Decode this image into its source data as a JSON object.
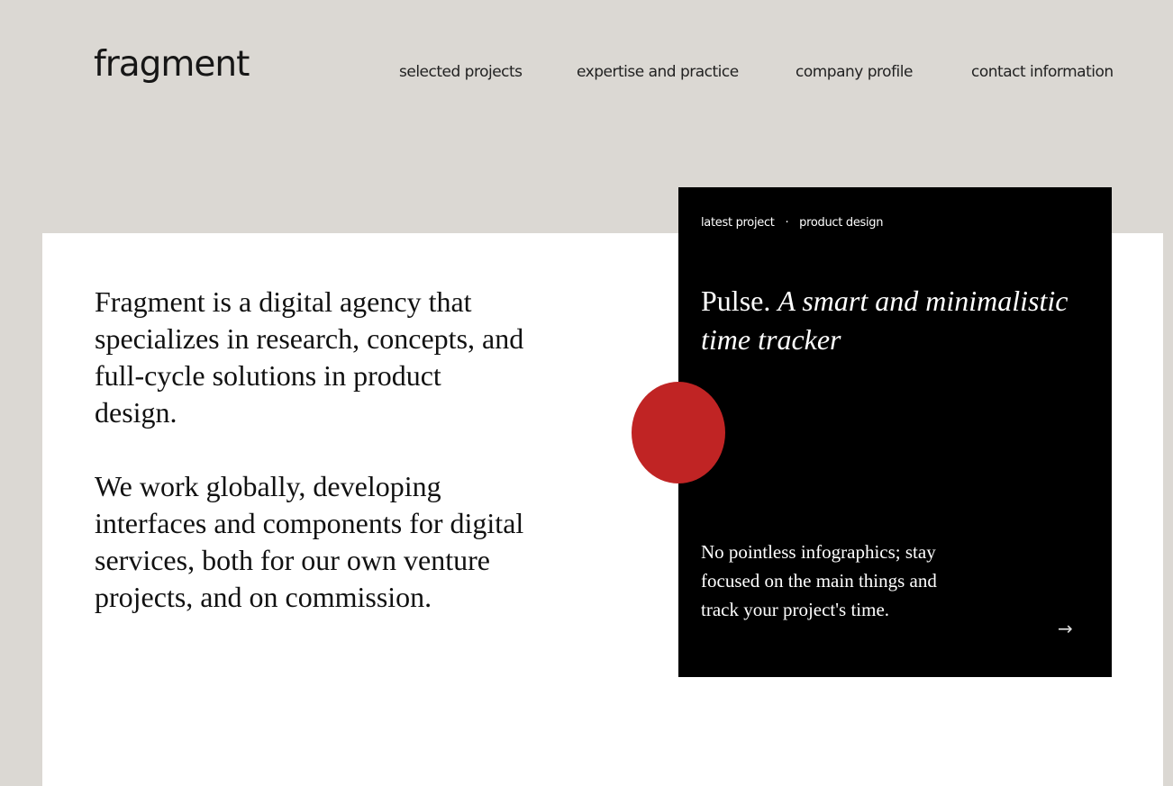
{
  "brand": {
    "logo": "fragment"
  },
  "nav": {
    "items": [
      {
        "label": "selected projects"
      },
      {
        "label": "expertise and practice"
      },
      {
        "label": "company profile"
      },
      {
        "label": "contact information"
      }
    ]
  },
  "intro": {
    "paragraph_1": "Fragment is a digital agency that specializes in research, concepts, and full-cycle solutions in product design.",
    "paragraph_2": "We work globally, developing interfaces and components for digital services, both for our own venture projects, and on commission."
  },
  "project_card": {
    "tag": "latest project",
    "separator": "·",
    "category": "product design",
    "title_name": "Pulse.",
    "title_tagline": "A smart and minimalistic time tracker",
    "description": "No pointless infographics; stay focused on the main things and track your project's time.",
    "arrow": "→"
  },
  "colors": {
    "background": "#dbd8d3",
    "panel": "#ffffff",
    "card": "#000000",
    "accent": "#c02424",
    "text": "#111111"
  },
  "icons": {
    "card_arrow": "arrow-right-icon",
    "accent_shape": "red-circle"
  }
}
